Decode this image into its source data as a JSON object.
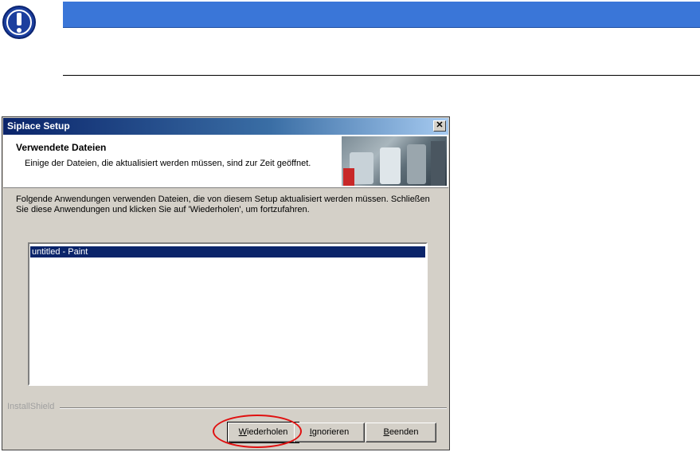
{
  "note": {
    "icon": "exclamation-icon",
    "accent_color": "#3a76d8"
  },
  "dialog": {
    "title": "Siplace Setup",
    "header_title": "Verwendete Dateien",
    "header_desc": "Einige der Dateien, die aktualisiert werden müssen, sind zur Zeit geöffnet.",
    "body_text": "Folgende Anwendungen verwenden Dateien, die von diesem Setup aktualisiert werden müssen. Schließen Sie diese Anwendungen und klicken Sie auf 'Wiederholen', um fortzufahren.",
    "list_items": [
      "untitled - Paint"
    ],
    "brand": "InstallShield",
    "buttons": {
      "retry": {
        "label": "Wiederholen",
        "mnemonic": "W",
        "rest": "iederholen"
      },
      "ignore": {
        "label": "Ignorieren",
        "mnemonic": "I",
        "rest": "gnorieren"
      },
      "quit": {
        "label": "Beenden",
        "mnemonic": "B",
        "rest": "eenden"
      }
    }
  },
  "highlight_color": "#e01010"
}
